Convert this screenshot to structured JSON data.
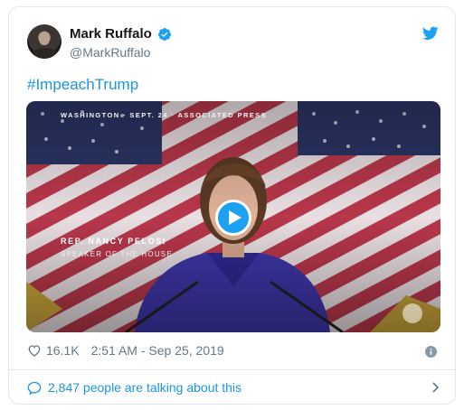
{
  "author": {
    "name": "Mark Ruffalo",
    "handle": "@MarkRuffalo"
  },
  "tweet": {
    "hashtag": "#ImpeachTrump"
  },
  "media": {
    "dateline": "WASHINGTON · SEPT. 24 · ASSOCIATED PRESS",
    "chyron_name": "REP. NANCY PELOSI",
    "chyron_title": "SPEAKER OF THE HOUSE"
  },
  "stats": {
    "likes": "16.1K",
    "timestamp": "2:51 AM - Sep 25, 2019"
  },
  "footer": {
    "talking": "2,847 people are talking about this"
  },
  "colors": {
    "accent": "#1da1f2",
    "link": "#1b95e0",
    "muted": "#657786"
  },
  "icons": [
    "verified-icon",
    "twitter-logo-icon",
    "play-icon",
    "heart-icon",
    "info-icon",
    "comment-bubble-icon",
    "chevron-right-icon"
  ]
}
